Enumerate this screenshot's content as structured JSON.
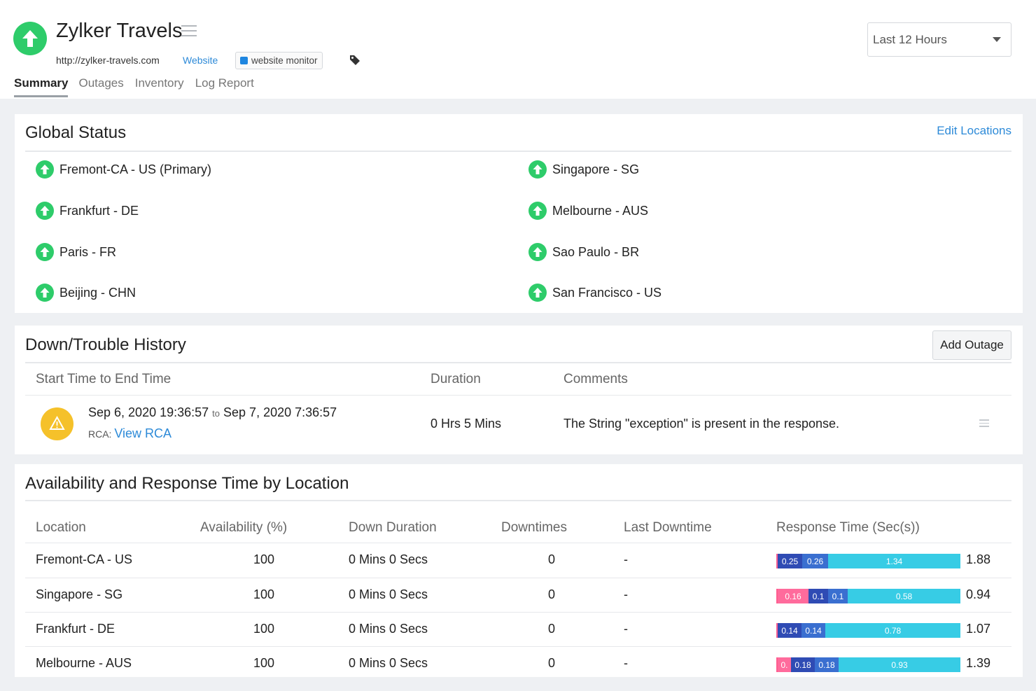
{
  "header": {
    "title": "Zylker Travels",
    "url": "http://zylker-travels.com",
    "type_link": "Website",
    "tag_label": "website monitor",
    "time_range": "Last 12 Hours",
    "status_color": "#2ecc6a",
    "icons": [
      "arrow-up-icon",
      "hamburger-icon",
      "tag-icon",
      "chevron-down-icon"
    ]
  },
  "tabs": [
    {
      "label": "Summary",
      "active": true
    },
    {
      "label": "Outages",
      "active": false
    },
    {
      "label": "Inventory",
      "active": false
    },
    {
      "label": "Log Report",
      "active": false
    }
  ],
  "global_status": {
    "title": "Global Status",
    "edit_link": "Edit Locations",
    "locations": [
      {
        "name": "Fremont-CA - US (Primary)",
        "status": "up"
      },
      {
        "name": "Singapore - SG",
        "status": "up"
      },
      {
        "name": "Frankfurt - DE",
        "status": "up"
      },
      {
        "name": "Melbourne - AUS",
        "status": "up"
      },
      {
        "name": "Paris - FR",
        "status": "up"
      },
      {
        "name": "Sao Paulo - BR",
        "status": "up"
      },
      {
        "name": "Beijing - CHN",
        "status": "up"
      },
      {
        "name": "San Francisco - US",
        "status": "up"
      }
    ]
  },
  "history": {
    "title": "Down/Trouble History",
    "add_button": "Add Outage",
    "columns": [
      "Start Time to End Time",
      "Duration",
      "Comments"
    ],
    "rows": [
      {
        "start": "Sep 6, 2020 19:36:57",
        "to": "to",
        "end": "Sep 7, 2020 7:36:57",
        "rca_label": "RCA:",
        "rca_link": "View RCA",
        "duration": "0 Hrs 5 Mins",
        "comment": "The String \"exception\" is present in the response.",
        "severity_color": "#f5c12a"
      }
    ]
  },
  "availability": {
    "title": "Availability and Response Time by Location",
    "columns": [
      "Location",
      "Availability (%)",
      "Down Duration",
      "Downtimes",
      "Last Downtime",
      "Response Time (Sec(s))"
    ],
    "rows": [
      {
        "location": "Fremont-CA - US",
        "availability": "100",
        "down_duration": "0 Mins 0 Secs",
        "downtimes": "0",
        "last_downtime": "-",
        "total": "1.88",
        "segments": [
          {
            "label": "0.25",
            "value": 0.25,
            "kind": "conn"
          },
          {
            "label": "0.26",
            "value": 0.26,
            "kind": "first"
          },
          {
            "label": "1.34",
            "value": 1.34,
            "kind": "dl"
          }
        ]
      },
      {
        "location": "Singapore - SG",
        "availability": "100",
        "down_duration": "0 Mins 0 Secs",
        "downtimes": "0",
        "last_downtime": "-",
        "total": "0.94",
        "segments": [
          {
            "label": "0.16",
            "value": 0.16,
            "kind": "dns"
          },
          {
            "label": "0.1",
            "value": 0.1,
            "kind": "conn"
          },
          {
            "label": "0.1",
            "value": 0.1,
            "kind": "first"
          },
          {
            "label": "0.58",
            "value": 0.58,
            "kind": "dl"
          }
        ]
      },
      {
        "location": "Frankfurt - DE",
        "availability": "100",
        "down_duration": "0 Mins 0 Secs",
        "downtimes": "0",
        "last_downtime": "-",
        "total": "1.07",
        "segments": [
          {
            "label": "0.14",
            "value": 0.14,
            "kind": "conn"
          },
          {
            "label": "0.14",
            "value": 0.14,
            "kind": "first"
          },
          {
            "label": "0.78",
            "value": 0.78,
            "kind": "dl"
          }
        ]
      },
      {
        "location": "Melbourne - AUS",
        "availability": "100",
        "down_duration": "0 Mins 0 Secs",
        "downtimes": "0",
        "last_downtime": "-",
        "total": "1.39",
        "segments": [
          {
            "label": "0.",
            "value": 0.1,
            "kind": "dns"
          },
          {
            "label": "0.18",
            "value": 0.18,
            "kind": "conn"
          },
          {
            "label": "0.18",
            "value": 0.18,
            "kind": "first"
          },
          {
            "label": "0.93",
            "value": 0.93,
            "kind": "dl"
          }
        ]
      }
    ]
  }
}
